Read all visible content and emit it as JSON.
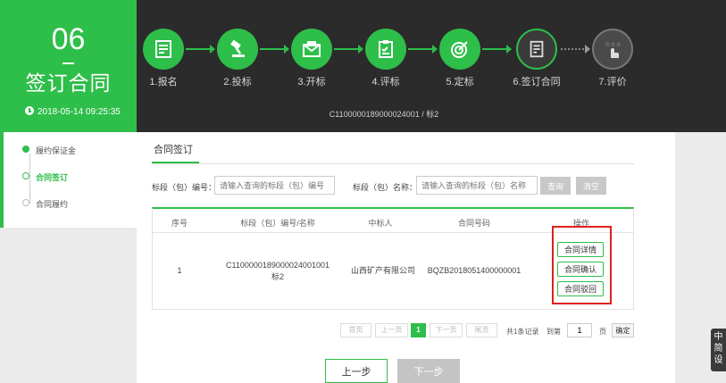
{
  "stage": {
    "number": "06",
    "name": "签订合同",
    "time": "2018-05-14 09:25:35"
  },
  "steps": [
    {
      "label": "1.报名",
      "icon": "form-icon",
      "state": "done"
    },
    {
      "label": "2.投标",
      "icon": "hammer-icon",
      "state": "done"
    },
    {
      "label": "3.开标",
      "icon": "envelope-icon",
      "state": "done"
    },
    {
      "label": "4.评标",
      "icon": "clipboard-icon",
      "state": "done"
    },
    {
      "label": "5.定标",
      "icon": "target-icon",
      "state": "done"
    },
    {
      "label": "6.签订合同",
      "icon": "contract-icon",
      "state": "current"
    },
    {
      "label": "7.评价",
      "icon": "rating-icon",
      "state": "todo"
    }
  ],
  "project_code": "C1100000189000024001 / 标2",
  "sidebar": {
    "items": [
      {
        "label": "履约保证金"
      },
      {
        "label": "合同签订"
      },
      {
        "label": "合同履约"
      }
    ]
  },
  "main": {
    "section_title": "合同签订",
    "search": {
      "code_label": "标段（包）编号：",
      "code_placeholder": "请输入查询的标段（包）编号",
      "name_label": "标段（包）名称：",
      "name_placeholder": "请输入查询的标段（包）名称",
      "query_button": "查询",
      "clear_button": "清空"
    },
    "table": {
      "headers": [
        "序号",
        "标段（包）编号/名称",
        "中标人",
        "合同号码",
        "操作"
      ],
      "row": {
        "index": "1",
        "code": "C1100000189000024001001",
        "name": "标2",
        "winner": "山西矿产有限公司",
        "contract_no": "BQZB2018051400000001"
      },
      "actions": [
        "合同详情",
        "合同确认",
        "合同驳回"
      ]
    },
    "pagination": {
      "first": "首页",
      "prev": "上一页",
      "current": "1",
      "next": "下一页",
      "last": "尾页",
      "total": "共1条记录",
      "goto_label": "到第",
      "page_value": "1",
      "page_unit": "页",
      "confirm": "确定"
    },
    "prev_step": "上一步",
    "next_step": "下一步"
  },
  "float_tab": "中\n简\n设",
  "colors": {
    "accent": "#2ebe4a",
    "header_bg": "#2b2b2b",
    "highlight": "#e0201b"
  }
}
